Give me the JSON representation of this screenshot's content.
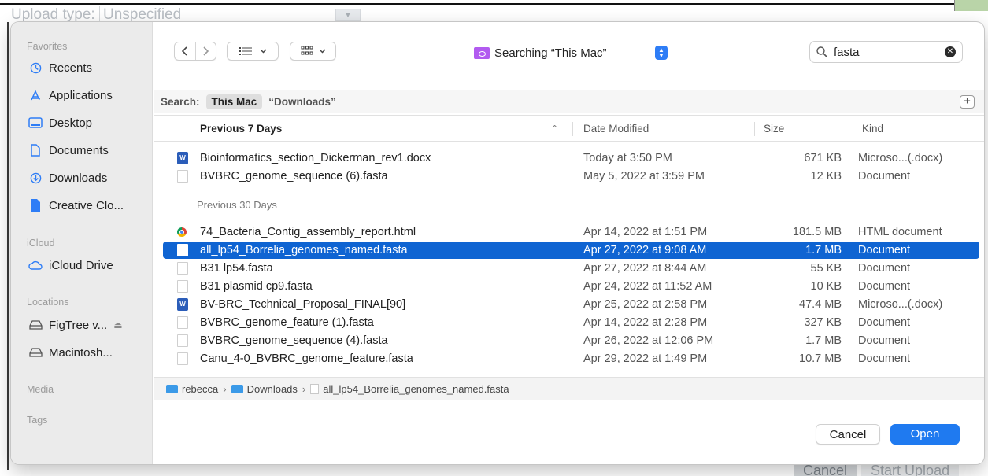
{
  "background": {
    "upload_type_label": "Upload type:",
    "upload_type_value": "Unspecified",
    "cancel_label": "Cancel",
    "start_upload_label": "Start Upload"
  },
  "sidebar": {
    "favorites_heading": "Favorites",
    "favorites": [
      {
        "label": "Recents",
        "icon": "clock-icon"
      },
      {
        "label": "Applications",
        "icon": "applications-icon"
      },
      {
        "label": "Desktop",
        "icon": "desktop-icon"
      },
      {
        "label": "Documents",
        "icon": "document-icon"
      },
      {
        "label": "Downloads",
        "icon": "download-icon"
      },
      {
        "label": "Creative Clo...",
        "icon": "file-icon"
      }
    ],
    "icloud_heading": "iCloud",
    "icloud": [
      {
        "label": "iCloud Drive",
        "icon": "cloud-icon"
      }
    ],
    "locations_heading": "Locations",
    "locations": [
      {
        "label": "FigTree v...",
        "icon": "drive-icon"
      },
      {
        "label": "Macintosh...",
        "icon": "drive-icon"
      }
    ],
    "media_heading": "Media",
    "tags_heading": "Tags"
  },
  "toolbar": {
    "location": "Searching “This Mac”",
    "search_value": "fasta"
  },
  "scope": {
    "label": "Search:",
    "this_mac": "This Mac",
    "downloads": "“Downloads”"
  },
  "columns": {
    "name": "Previous 7 Days",
    "date": "Date Modified",
    "size": "Size",
    "kind": "Kind"
  },
  "groups": {
    "previous_30": "Previous 30 Days"
  },
  "files": [
    {
      "name": "Bioinformatics_section_Dickerman_rev1.docx",
      "date": "Today at 3:50 PM",
      "size": "671 KB",
      "kind": "Microso...(.docx)",
      "icon": "word-icon"
    },
    {
      "name": "BVBRC_genome_sequence (6).fasta",
      "date": "May 5, 2022 at 3:59 PM",
      "size": "12 KB",
      "kind": "Document",
      "icon": "document-icon"
    },
    {
      "name": "74_Bacteria_Contig_assembly_report.html",
      "date": "Apr 14, 2022 at 1:51 PM",
      "size": "181.5 MB",
      "kind": "HTML document",
      "icon": "chrome-icon"
    },
    {
      "name": "all_lp54_Borrelia_genomes_named.fasta",
      "date": "Apr 27, 2022 at 9:08 AM",
      "size": "1.7 MB",
      "kind": "Document",
      "icon": "document-icon",
      "selected": true
    },
    {
      "name": "B31 lp54.fasta",
      "date": "Apr 27, 2022 at 8:44 AM",
      "size": "55 KB",
      "kind": "Document",
      "icon": "document-icon"
    },
    {
      "name": "B31 plasmid cp9.fasta",
      "date": "Apr 24, 2022 at 11:52 AM",
      "size": "10 KB",
      "kind": "Document",
      "icon": "document-icon"
    },
    {
      "name": "BV-BRC_Technical_Proposal_FINAL[90]",
      "date": "Apr 25, 2022 at 2:58 PM",
      "size": "47.4 MB",
      "kind": "Microso...(.docx)",
      "icon": "word-icon"
    },
    {
      "name": "BVBRC_genome_feature (1).fasta",
      "date": "Apr 14, 2022 at 2:28 PM",
      "size": "327 KB",
      "kind": "Document",
      "icon": "document-icon"
    },
    {
      "name": "BVBRC_genome_sequence (4).fasta",
      "date": "Apr 26, 2022 at 12:06 PM",
      "size": "1.7 MB",
      "kind": "Document",
      "icon": "document-icon"
    },
    {
      "name": "Canu_4-0_BVBRC_genome_feature.fasta",
      "date": "Apr 29, 2022 at 1:49 PM",
      "size": "10.7 MB",
      "kind": "Document",
      "icon": "document-icon"
    }
  ],
  "path": {
    "user": "rebecca",
    "folder": "Downloads",
    "file": "all_lp54_Borrelia_genomes_named.fasta"
  },
  "buttons": {
    "cancel": "Cancel",
    "open": "Open"
  },
  "colors": {
    "accent": "#0f64d2",
    "open_button": "#1f7af0",
    "location_folder": "#b25bf0"
  }
}
